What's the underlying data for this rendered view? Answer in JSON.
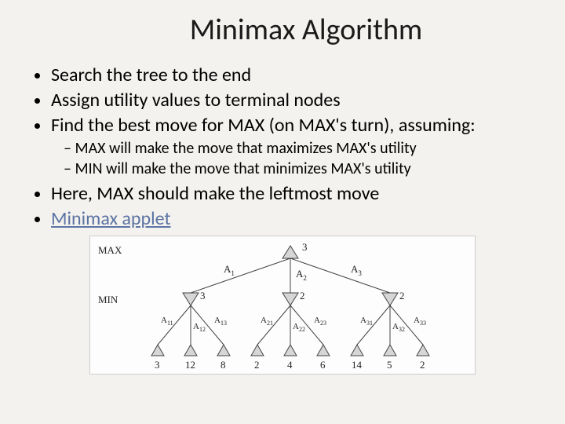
{
  "title": "Minimax Algorithm",
  "bullets": {
    "b1": "Search the tree to the end",
    "b2": "Assign utility values to terminal nodes",
    "b3": "Find the best move for MAX (on MAX's turn), assuming:",
    "b3a": "MAX will make the move that maximizes MAX's utility",
    "b3b": "MIN will make the move that minimizes MAX's utility",
    "b4": "Here, MAX should make the leftmost move",
    "b5": "Minimax applet"
  },
  "tree": {
    "row_labels": {
      "max": "MAX",
      "min": "MIN"
    },
    "root": {
      "value": "3"
    },
    "actions_top": [
      "A",
      "A",
      "A"
    ],
    "actions_top_sub": [
      "1",
      "2",
      "3"
    ],
    "min_nodes": [
      {
        "value": "3"
      },
      {
        "value": "2"
      },
      {
        "value": "2"
      }
    ],
    "actions_bottom": [
      [
        "A",
        "A",
        "A"
      ],
      [
        "A",
        "A",
        "A"
      ],
      [
        "A",
        "A",
        "A"
      ]
    ],
    "actions_bottom_sub": [
      [
        "11",
        "12",
        "13"
      ],
      [
        "21",
        "22",
        "23"
      ],
      [
        "31",
        "32",
        "33"
      ]
    ],
    "leaves": [
      "3",
      "12",
      "8",
      "2",
      "4",
      "6",
      "14",
      "5",
      "2"
    ]
  }
}
